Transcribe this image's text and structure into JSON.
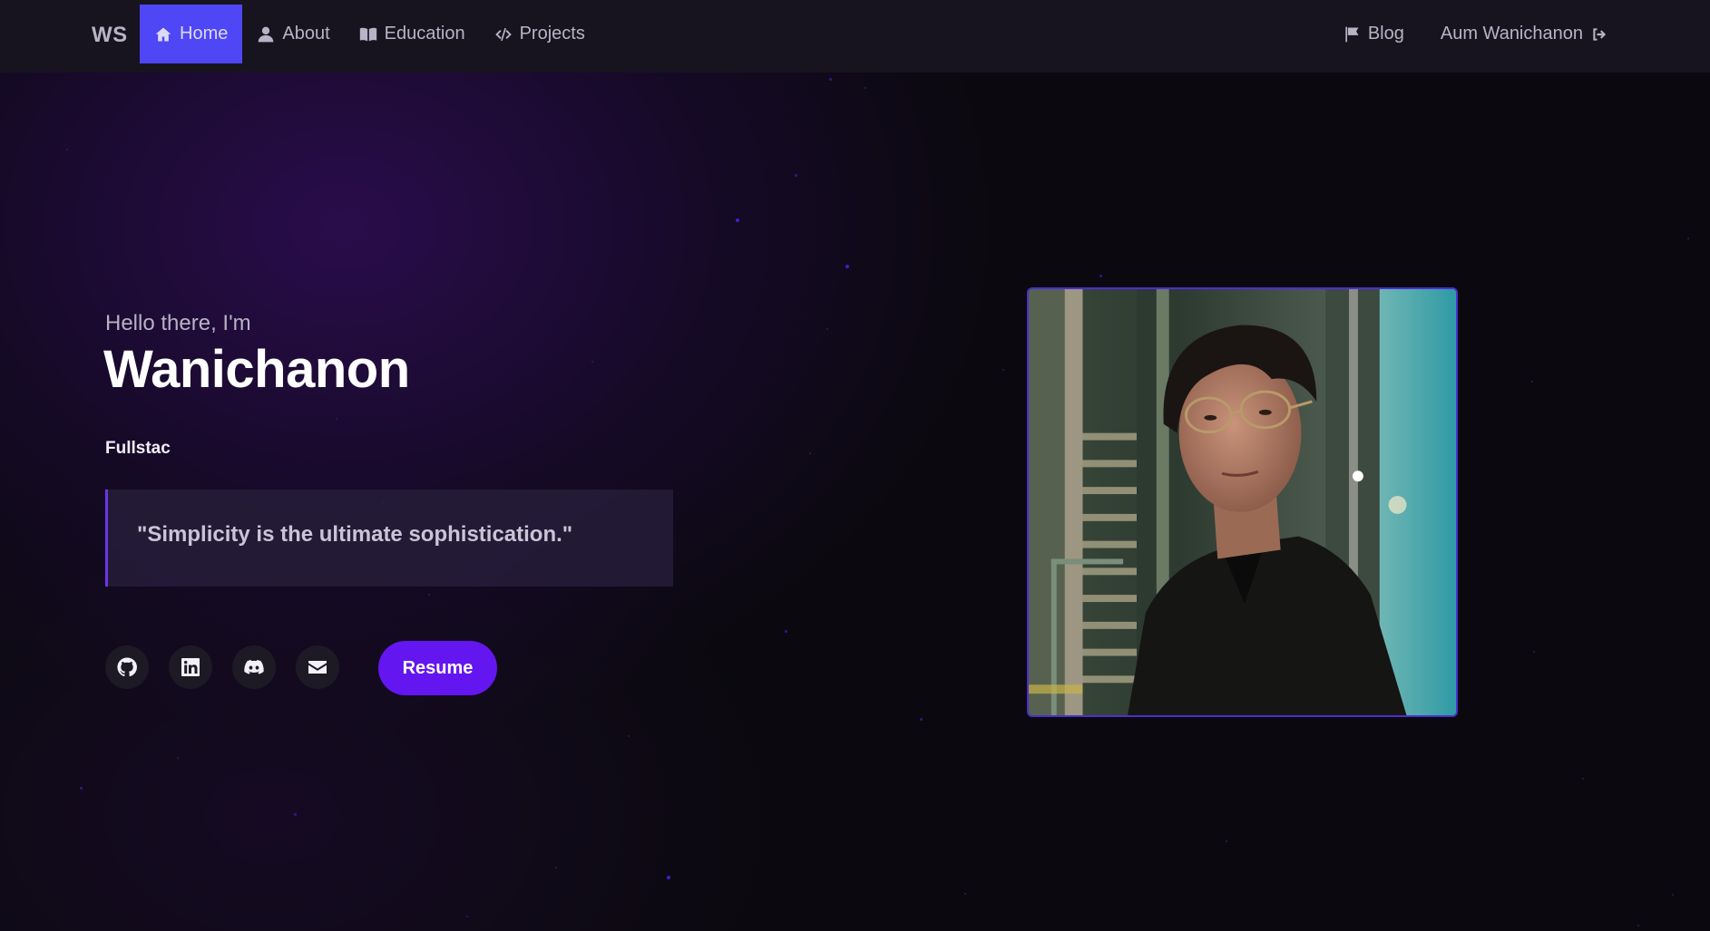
{
  "navbar": {
    "brand": "WS",
    "items": [
      {
        "label": "Home",
        "icon": "home-icon",
        "active": true
      },
      {
        "label": "About",
        "icon": "user-icon",
        "active": false
      },
      {
        "label": "Education",
        "icon": "book-open-icon",
        "active": false
      },
      {
        "label": "Projects",
        "icon": "code-icon",
        "active": false
      }
    ],
    "right": {
      "blog_label": "Blog",
      "blog_icon": "flag-icon",
      "user_name": "Aum Wanichanon",
      "logout_icon": "sign-out-icon"
    }
  },
  "hero": {
    "greeting": "Hello there, I'm",
    "name": "Wanichanon",
    "role": "Fullstac",
    "quote": "\"Simplicity is the ultimate sophistication.\"",
    "socials": [
      {
        "icon": "github-icon"
      },
      {
        "icon": "linkedin-icon"
      },
      {
        "icon": "discord-icon"
      },
      {
        "icon": "email-icon"
      }
    ],
    "resume_label": "Resume"
  },
  "colors": {
    "accent": "#6416f0",
    "nav_active": "#4f46f5",
    "background": "#0b090f",
    "navbar": "#17141f"
  }
}
